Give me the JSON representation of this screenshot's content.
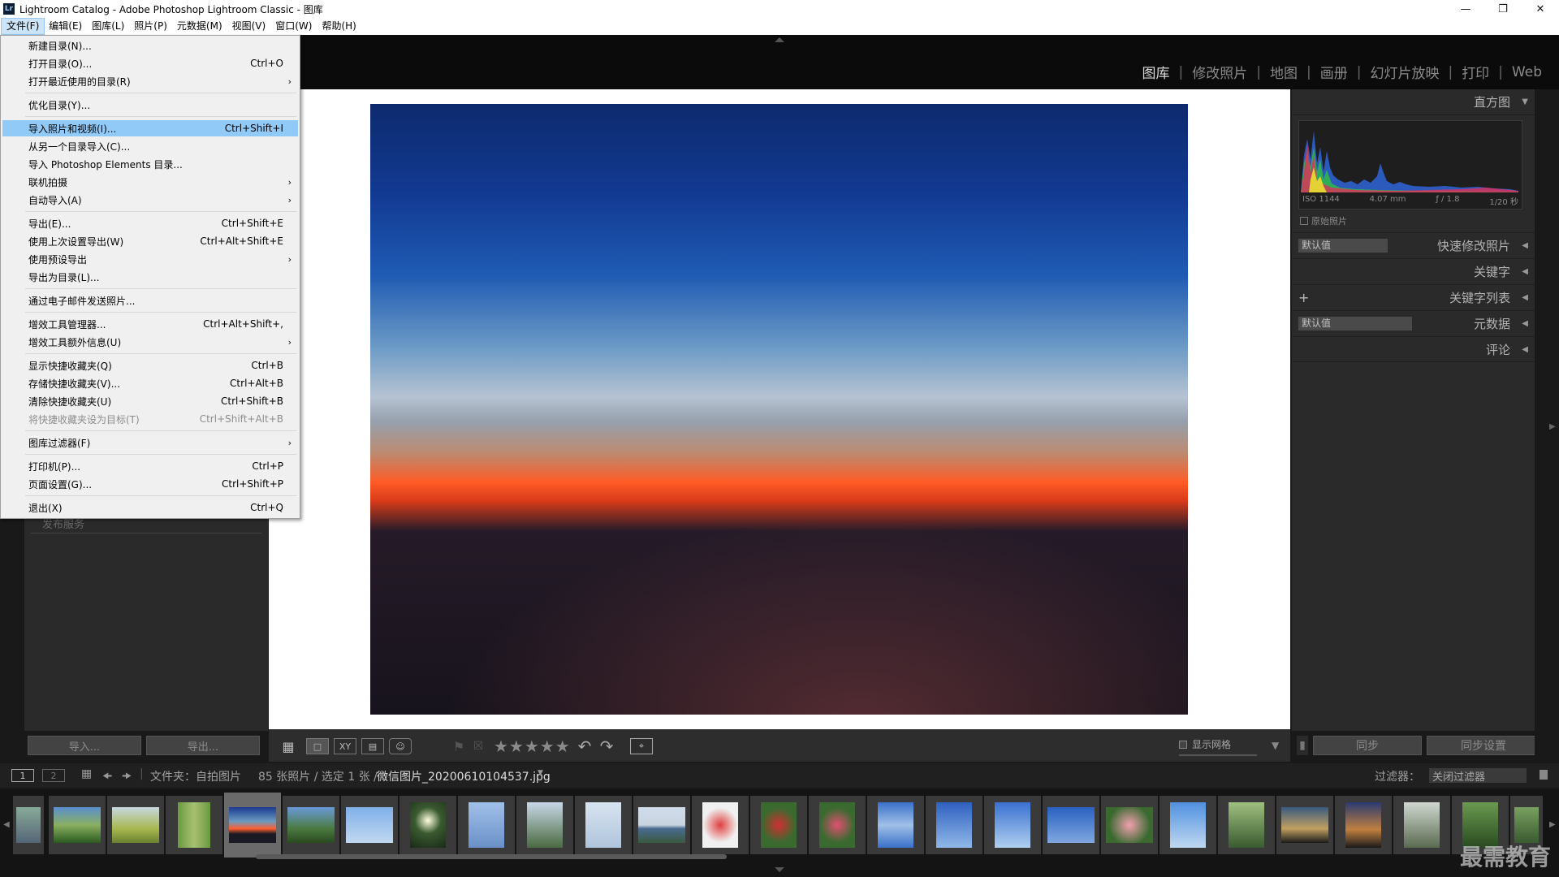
{
  "window": {
    "title": "Lightroom Catalog - Adobe Photoshop Lightroom Classic - 图库",
    "app_icon": "Lr"
  },
  "menubar": [
    "文件(F)",
    "编辑(E)",
    "图库(L)",
    "照片(P)",
    "元数据(M)",
    "视图(V)",
    "窗口(W)",
    "帮助(H)"
  ],
  "file_menu": [
    {
      "label": "新建目录(N)...",
      "key": ""
    },
    {
      "label": "打开目录(O)...",
      "key": "Ctrl+O"
    },
    {
      "label": "打开最近使用的目录(R)",
      "key": "",
      "submenu": true
    },
    {
      "label": "优化目录(Y)...",
      "key": ""
    },
    {
      "label": "导入照片和视频(I)...",
      "key": "Ctrl+Shift+I",
      "highlighted": true
    },
    {
      "label": "从另一个目录导入(C)...",
      "key": ""
    },
    {
      "label": "导入 Photoshop Elements 目录...",
      "key": ""
    },
    {
      "label": "联机拍摄",
      "key": "",
      "submenu": true
    },
    {
      "label": "自动导入(A)",
      "key": "",
      "submenu": true
    },
    {
      "label": "导出(E)...",
      "key": "Ctrl+Shift+E"
    },
    {
      "label": "使用上次设置导出(W)",
      "key": "Ctrl+Alt+Shift+E"
    },
    {
      "label": "使用预设导出",
      "key": "",
      "submenu": true
    },
    {
      "label": "导出为目录(L)...",
      "key": ""
    },
    {
      "label": "通过电子邮件发送照片...",
      "key": ""
    },
    {
      "label": "增效工具管理器...",
      "key": "Ctrl+Alt+Shift+,"
    },
    {
      "label": "增效工具额外信息(U)",
      "key": "",
      "submenu": true
    },
    {
      "label": "显示快捷收藏夹(Q)",
      "key": "Ctrl+B"
    },
    {
      "label": "存储快捷收藏夹(V)...",
      "key": "Ctrl+Alt+B"
    },
    {
      "label": "清除快捷收藏夹(U)",
      "key": "Ctrl+Shift+B"
    },
    {
      "label": "将快捷收藏夹设为目标(T)",
      "key": "Ctrl+Shift+Alt+B",
      "disabled": true
    },
    {
      "label": "图库过滤器(F)",
      "key": "",
      "submenu": true
    },
    {
      "label": "打印机(P)...",
      "key": "Ctrl+P"
    },
    {
      "label": "页面设置(G)...",
      "key": "Ctrl+Shift+P"
    },
    {
      "label": "退出(X)",
      "key": "Ctrl+Q"
    }
  ],
  "modules": [
    "图库",
    "修改照片",
    "地图",
    "画册",
    "幻灯片放映",
    "打印",
    "Web"
  ],
  "left_buttons": {
    "import": "导入...",
    "export": "导出..."
  },
  "left_hidden_text": "发布服务",
  "right_panel": {
    "histogram": "直方图",
    "exif": {
      "iso": "ISO 1144",
      "focal": "4.07 mm",
      "aperture": "ƒ / 1.8",
      "shutter": "1/20 秒"
    },
    "original_photo": "原始照片",
    "quick_develop": {
      "preset": "默认值",
      "label": "快速修改照片"
    },
    "keywords": "关键字",
    "keyword_list": "关键字列表",
    "metadata": {
      "preset": "默认值",
      "label": "元数据"
    },
    "comments": "评论",
    "sync": "同步",
    "sync_settings": "同步设置"
  },
  "toolbar": {
    "stars": "★★★★★",
    "show_grid": "显示网格"
  },
  "filmstrip_bar": {
    "page1": "1",
    "page2": "2",
    "source": "文件夹：自拍图片",
    "count": "85 张照片 / 选定 1 张 /",
    "filename": "微信图片_20200610104537.jpg",
    "filter_label": "过滤器：",
    "filter_value": "关闭过滤器"
  },
  "watermark": "最需教育"
}
